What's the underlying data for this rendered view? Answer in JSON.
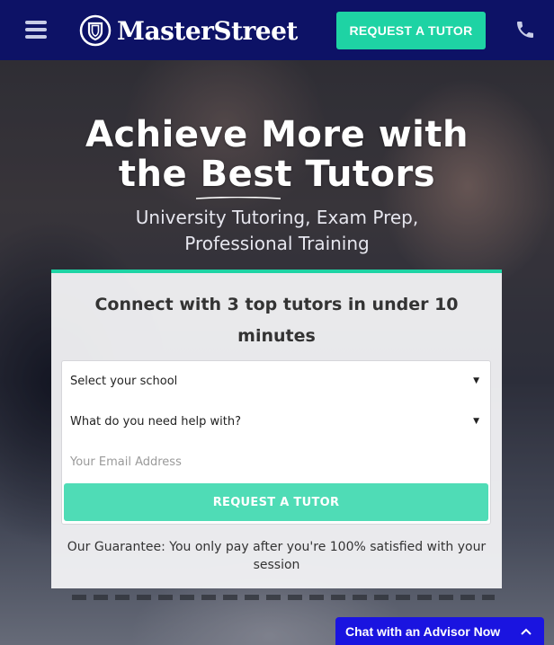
{
  "header": {
    "brand": "MasterStreet",
    "cta_label": "REQUEST A TUTOR",
    "icons": {
      "menu": "hamburger-menu-icon",
      "phone": "phone-icon",
      "logo": "shield-logo-icon"
    }
  },
  "hero": {
    "title_line1": "Achieve More with",
    "title_line2": "the Best Tutors",
    "subtitle_line1": "University Tutoring, Exam Prep,",
    "subtitle_line2": "Professional Training"
  },
  "form": {
    "title": "Connect with 3 top tutors in under 10 minutes",
    "school_select": "Select your school",
    "help_select": "What do you need help with?",
    "email_placeholder": "Your Email Address",
    "submit_label": "REQUEST A TUTOR",
    "guarantee": "Our Guarantee: You only pay after you're 100% satisfied with your session"
  },
  "chat": {
    "label": "Chat with an Advisor Now",
    "icon": "chevron-up-icon"
  },
  "colors": {
    "navy": "#0d1266",
    "accent": "#1ed3a4",
    "accent_light": "#4fdcb6",
    "chat_blue": "#1a14e0"
  }
}
